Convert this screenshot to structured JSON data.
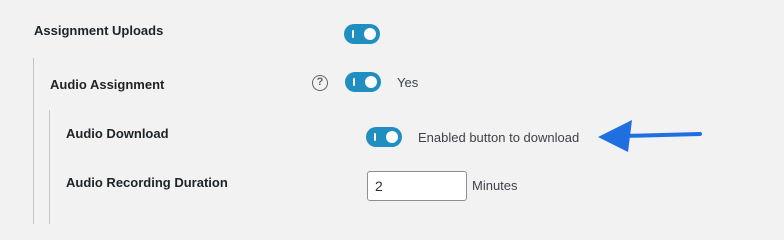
{
  "settings": {
    "assignment_uploads": {
      "label": "Assignment Uploads",
      "enabled": true
    },
    "audio_assignment": {
      "label": "Audio Assignment",
      "help_glyph": "?",
      "enabled": true,
      "status": "Yes"
    },
    "audio_download": {
      "label": "Audio Download",
      "enabled": true,
      "description": "Enabled button to download"
    },
    "audio_recording_duration": {
      "label": "Audio Recording Duration",
      "value": "2",
      "unit": "Minutes"
    }
  },
  "annotation": {
    "arrow_color": "#1f6fe0",
    "arrow_direction": "left"
  },
  "colors": {
    "toggle_on": "#1f8ec1"
  }
}
